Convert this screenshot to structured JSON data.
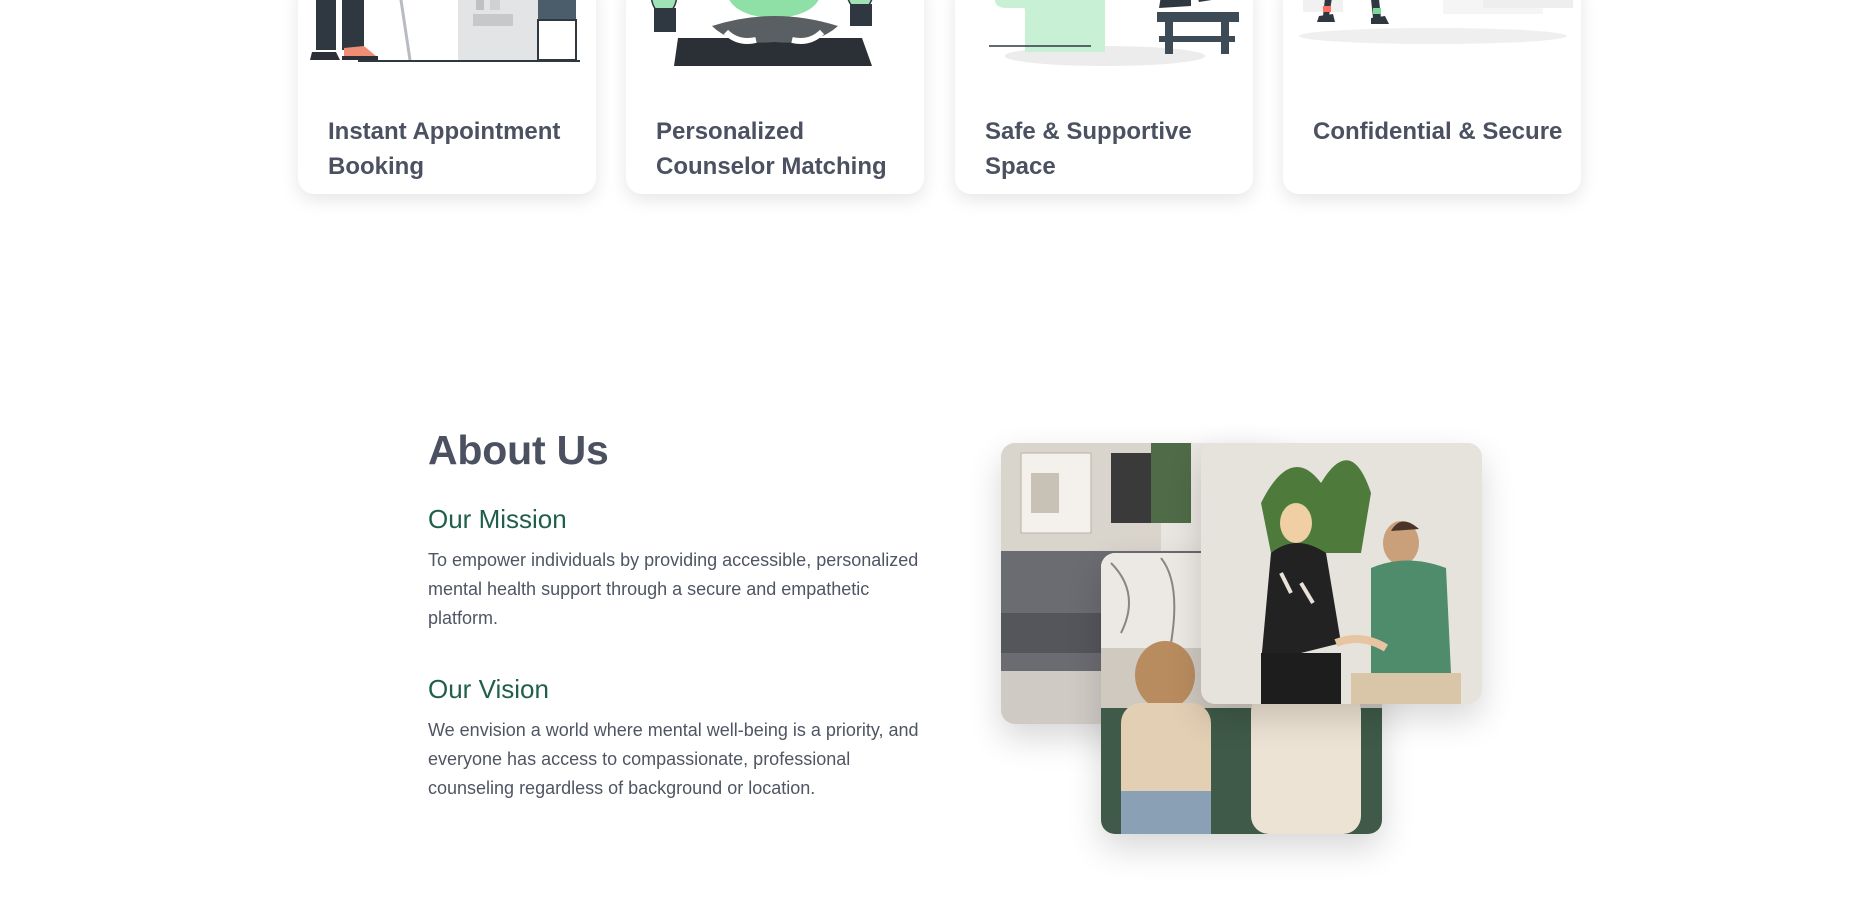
{
  "features": {
    "cards": [
      {
        "title": "Instant Appointment Booking",
        "illustration": "person-at-desk-illustration"
      },
      {
        "title": "Personalized Counselor Matching",
        "illustration": "meditation-illustration"
      },
      {
        "title": "Safe & Supportive Space",
        "illustration": "relaxing-chair-illustration"
      },
      {
        "title": "Confidential & Secure",
        "illustration": "walking-person-illustration"
      }
    ]
  },
  "about": {
    "title": "About Us",
    "mission": {
      "heading": "Our Mission",
      "text": "To empower individuals by providing accessible, personalized mental health support through a secure and empathetic platform."
    },
    "vision": {
      "heading": "Our Vision",
      "text": "We envision a world where mental well-being is a priority, and everyone has access to compassionate, professional counseling regardless of background or location."
    },
    "photos": [
      "living-room-photo",
      "counseling-session-photo",
      "consoling-photo"
    ]
  },
  "colors": {
    "heading": "#4b5160",
    "accent_green": "#1f5f4b",
    "illustration_green": "#9fe3b4",
    "dark_slate": "#3d4b57"
  }
}
